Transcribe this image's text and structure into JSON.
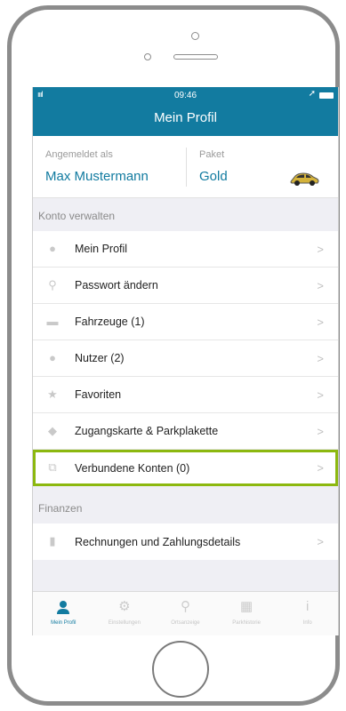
{
  "status_bar": {
    "signal": "ıııl",
    "time": "09:46",
    "arrow": "➚"
  },
  "header": {
    "title": "Mein Profil"
  },
  "account": {
    "logged_in_label": "Angemeldet als",
    "user_name": "Max Mustermann",
    "package_label": "Paket",
    "package_value": "Gold"
  },
  "sections": {
    "account_header": "Konto verwalten",
    "finance_header": "Finanzen"
  },
  "account_items": [
    {
      "label": "Mein Profil",
      "icon": "person-icon"
    },
    {
      "label": "Passwort ändern",
      "icon": "key-icon"
    },
    {
      "label": "Fahrzeuge (1)",
      "icon": "car-icon"
    },
    {
      "label": "Nutzer (2)",
      "icon": "users-icon"
    },
    {
      "label": "Favoriten",
      "icon": "star-icon"
    },
    {
      "label": "Zugangskarte & Parkplakette",
      "icon": "card-icon"
    },
    {
      "label": "Verbundene Konten (0)",
      "icon": "link-icon"
    }
  ],
  "finance_items": [
    {
      "label": "Rechnungen und Zahlungsdetails",
      "icon": "document-icon"
    }
  ],
  "chevron": ">",
  "tabs": [
    {
      "label": "Mein Profil",
      "icon": "profile-icon",
      "active": true
    },
    {
      "label": "Einstellungen",
      "icon": "gear-icon",
      "active": false
    },
    {
      "label": "Ortsanzeige",
      "icon": "location-pin-icon",
      "active": false
    },
    {
      "label": "Parkhistorie",
      "icon": "calendar-icon",
      "active": false
    },
    {
      "label": "Info",
      "icon": "info-icon",
      "active": false
    }
  ],
  "colors": {
    "primary": "#127ba0",
    "highlight": "#8cb80f",
    "background": "#efeff4"
  }
}
